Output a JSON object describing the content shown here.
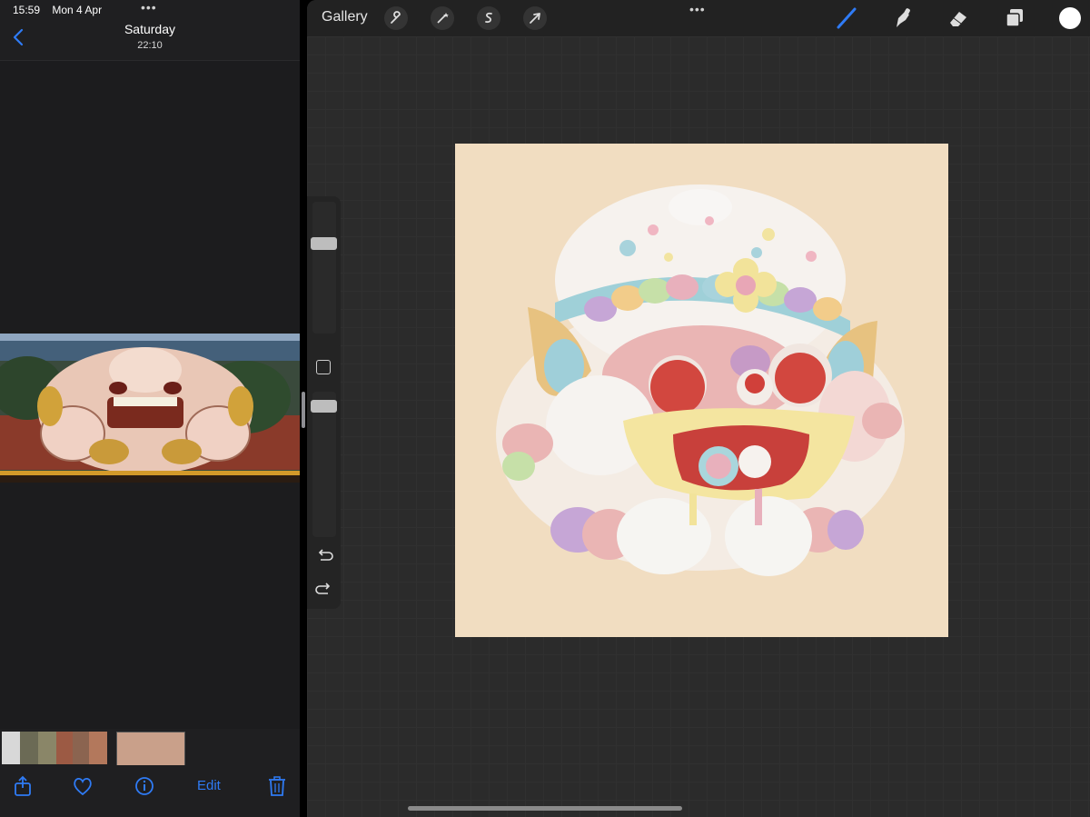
{
  "status_bar": {
    "time": "15:59",
    "date": "Mon 4 Apr"
  },
  "photos": {
    "title": "Saturday",
    "subtitle": "22:10",
    "edit_label": "Edit"
  },
  "procreate": {
    "gallery_label": "Gallery",
    "icons": [
      "wrench-icon",
      "magic-wand-icon",
      "selection-icon",
      "transform-icon",
      "brush-icon",
      "smudge-icon",
      "eraser-icon",
      "layers-icon"
    ],
    "current_color": "#ffffff",
    "canvas_background": "#f1ddc1"
  },
  "accent_color": "#2f7bf5"
}
